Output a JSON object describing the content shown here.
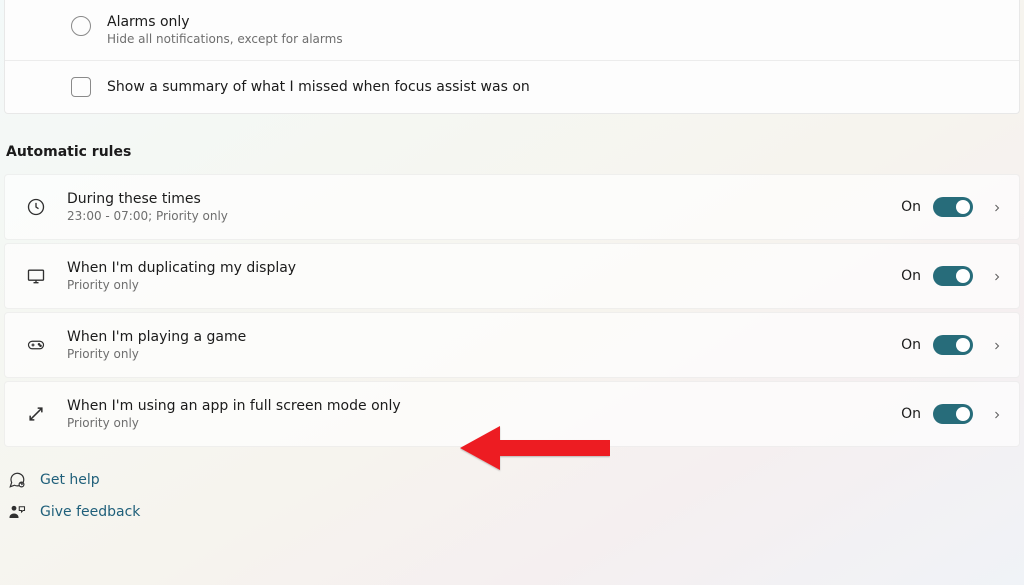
{
  "alarms_option": {
    "label": "Alarms only",
    "description": "Hide all notifications, except for alarms"
  },
  "summary_checkbox": {
    "label": "Show a summary of what I missed when focus assist was on"
  },
  "section_title": "Automatic rules",
  "rules": [
    {
      "title": "During these times",
      "subtitle": "23:00 - 07:00; Priority only",
      "status": "On"
    },
    {
      "title": "When I'm duplicating my display",
      "subtitle": "Priority only",
      "status": "On"
    },
    {
      "title": "When I'm playing a game",
      "subtitle": "Priority only",
      "status": "On"
    },
    {
      "title": "When I'm using an app in full screen mode only",
      "subtitle": "Priority only",
      "status": "On"
    }
  ],
  "footer": {
    "help": "Get help",
    "feedback": "Give feedback"
  }
}
